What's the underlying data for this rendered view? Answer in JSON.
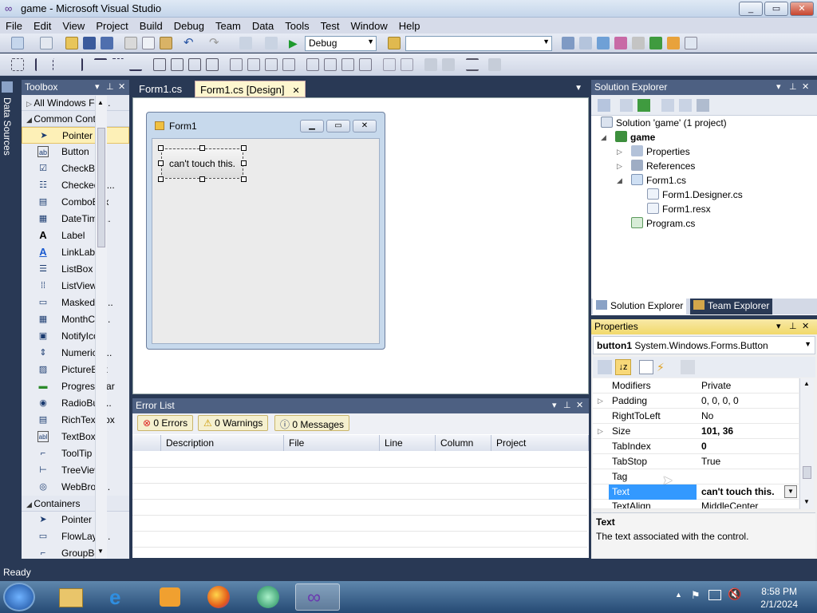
{
  "window": {
    "title": "game - Microsoft Visual Studio",
    "controls": [
      "_",
      "▭",
      "✕"
    ]
  },
  "menu": [
    "File",
    "Edit",
    "View",
    "Project",
    "Build",
    "Debug",
    "Team",
    "Data",
    "Tools",
    "Test",
    "Window",
    "Help"
  ],
  "toolbar": {
    "config": "Debug",
    "platform": ""
  },
  "sidetab": "Data Sources",
  "toolbox": {
    "title": "Toolbox",
    "categories": [
      {
        "name": "All Windows For...",
        "expanded": false
      },
      {
        "name": "Common Contr...",
        "expanded": true
      }
    ],
    "common_items": [
      "Pointer",
      "Button",
      "CheckBox",
      "CheckedLi...",
      "ComboBox",
      "DateTime...",
      "Label",
      "LinkLabel",
      "ListBox",
      "ListView",
      "MaskedTe...",
      "MonthCal...",
      "NotifyIcon",
      "NumericU...",
      "PictureBox",
      "ProgressBar",
      "RadioButt...",
      "RichTextBox",
      "TextBox",
      "ToolTip",
      "TreeView",
      "WebBrow..."
    ],
    "containers": {
      "name": "Containers",
      "items": [
        "Pointer",
        "FlowLayo...",
        "GroupBox"
      ]
    }
  },
  "doc_tabs": [
    {
      "label": "Form1.cs"
    },
    {
      "label": "Form1.cs [Design]"
    }
  ],
  "form": {
    "caption": "Form1",
    "button_text": "can't touch this."
  },
  "errorlist": {
    "title": "Error List",
    "filters": {
      "errors": "0 Errors",
      "warnings": "0 Warnings",
      "messages": "0 Messages"
    },
    "columns": [
      "Description",
      "File",
      "Line",
      "Column",
      "Project"
    ]
  },
  "solution": {
    "title": "Solution Explorer",
    "root": "Solution 'game' (1 project)",
    "project": "game",
    "items": [
      "Properties",
      "References",
      "Form1.cs",
      "Form1.Designer.cs",
      "Form1.resx",
      "Program.cs"
    ],
    "tabs": [
      "Solution Explorer",
      "Team Explorer"
    ]
  },
  "properties": {
    "title": "Properties",
    "object": "button1",
    "object_type": "System.Windows.Forms.Button",
    "rows": [
      {
        "name": "Modifiers",
        "value": "Private",
        "expandable": false,
        "bold": false
      },
      {
        "name": "Padding",
        "value": "0, 0, 0, 0",
        "expandable": true,
        "bold": false
      },
      {
        "name": "RightToLeft",
        "value": "No",
        "expandable": false,
        "bold": false
      },
      {
        "name": "Size",
        "value": "101, 36",
        "expandable": true,
        "bold": true
      },
      {
        "name": "TabIndex",
        "value": "0",
        "expandable": false,
        "bold": true
      },
      {
        "name": "TabStop",
        "value": "True",
        "expandable": false,
        "bold": false
      },
      {
        "name": "Tag",
        "value": "",
        "expandable": false,
        "bold": false
      },
      {
        "name": "Text",
        "value": "can't touch this.",
        "expandable": false,
        "bold": true
      },
      {
        "name": "TextAlign",
        "value": "MiddleCenter",
        "expandable": false,
        "bold": false
      }
    ],
    "desc_title": "Text",
    "desc_text": "The text associated with the control."
  },
  "status": "Ready",
  "clock": {
    "time": "8:58 PM",
    "date": "2/1/2024"
  }
}
